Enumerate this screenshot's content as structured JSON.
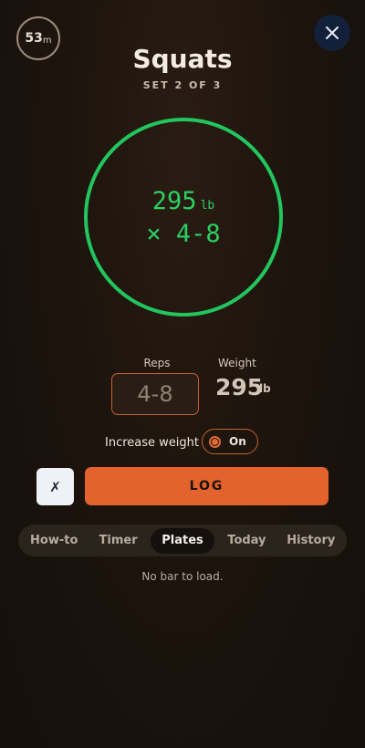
{
  "timer": {
    "value": "53",
    "unit": "m"
  },
  "exercise": {
    "title": "Squats",
    "set_label": "SET 2 OF 3"
  },
  "target": {
    "weight": "295",
    "weight_unit": "lb",
    "reps": "× 4-8"
  },
  "inputs": {
    "reps_label": "Reps",
    "reps_placeholder": "4-8",
    "weight_label": "Weight",
    "weight_value": "295",
    "weight_unit": "lb"
  },
  "increase_weight": {
    "label": "Increase weight",
    "toggle_label": "On",
    "enabled": true
  },
  "actions": {
    "skip_label": "✗",
    "log_label": "LOG"
  },
  "tabs": [
    {
      "label": "How-to"
    },
    {
      "label": "Timer"
    },
    {
      "label": "Plates",
      "active": true
    },
    {
      "label": "Today"
    },
    {
      "label": "History"
    }
  ],
  "plates_message": "No bar to load.",
  "colors": {
    "accent": "#e3622d",
    "ring": "#22c55e",
    "close_bg": "#13203a"
  }
}
